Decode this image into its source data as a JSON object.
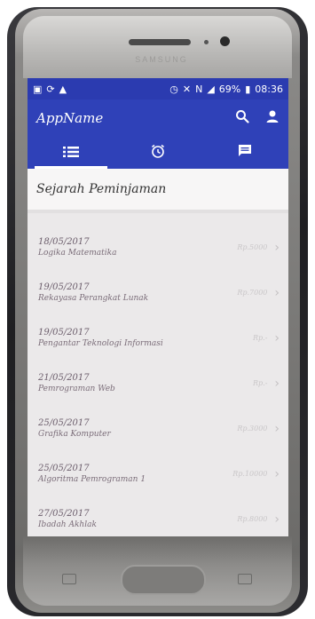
{
  "device": {
    "brand": "SAMSUNG"
  },
  "status_bar": {
    "battery": "69%",
    "time": "08:36"
  },
  "app_bar": {
    "title": "AppName"
  },
  "tabs": [
    {
      "icon": "list-icon",
      "active": true
    },
    {
      "icon": "alarm-icon",
      "active": false
    },
    {
      "icon": "chat-icon",
      "active": false
    }
  ],
  "section": {
    "title": "Sejarah Peminjaman"
  },
  "history": [
    {
      "date": "18/05/2017",
      "course": "Logika Matematika",
      "price": "Rp.5000"
    },
    {
      "date": "19/05/2017",
      "course": "Rekayasa Perangkat Lunak",
      "price": "Rp.7000"
    },
    {
      "date": "19/05/2017",
      "course": "Pengantar Teknologi Informasi",
      "price": "Rp.-"
    },
    {
      "date": "21/05/2017",
      "course": "Pemrograman Web",
      "price": "Rp.-"
    },
    {
      "date": "25/05/2017",
      "course": "Grafika Komputer",
      "price": "Rp.3000"
    },
    {
      "date": "25/05/2017",
      "course": "Algoritma Pemrograman 1",
      "price": "Rp.10000"
    },
    {
      "date": "27/05/2017",
      "course": "Ibadah Akhlak",
      "price": "Rp.8000"
    }
  ],
  "colors": {
    "primary": "#2f41b8",
    "status_bar": "#2b3bb0",
    "background": "#ebe9ea"
  }
}
